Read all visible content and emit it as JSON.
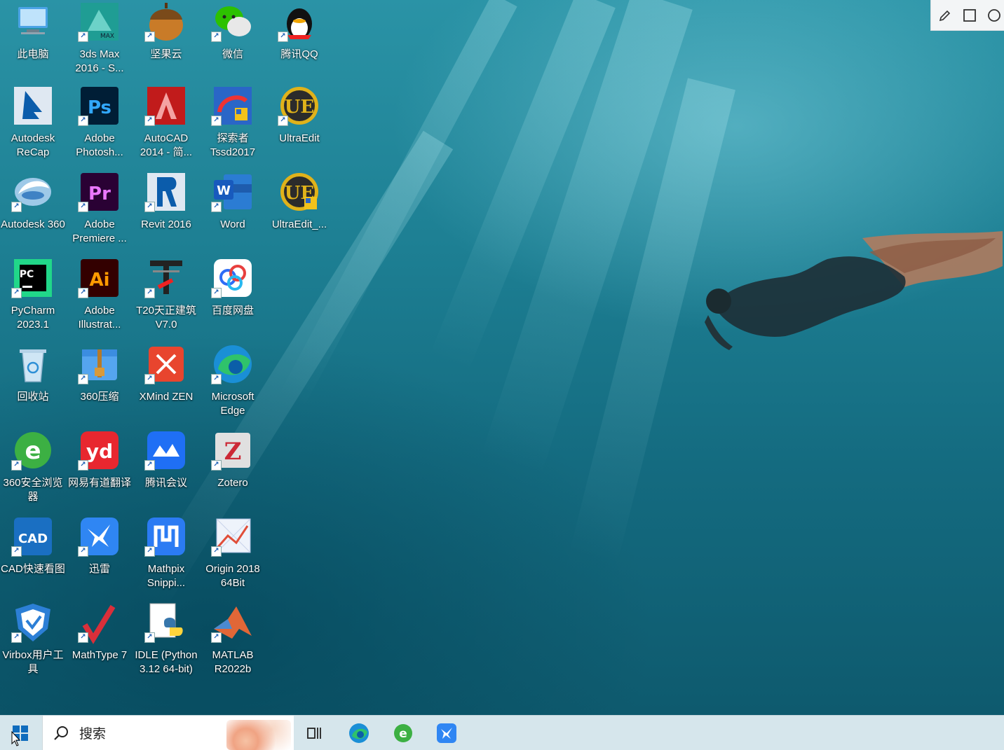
{
  "taskbar": {
    "search_placeholder": "搜索",
    "apps": [
      "task-view-icon",
      "edge-icon",
      "360-browser-icon",
      "xunlei-icon"
    ]
  },
  "snip_toolbar": {
    "tools": [
      "pencil-icon",
      "rectangle-icon",
      "circle-icon"
    ]
  },
  "desktop": {
    "icons": [
      {
        "label": "此电脑",
        "icon": "this-pc-icon",
        "shortcut": false
      },
      {
        "label": "3ds Max 2016 - S...",
        "icon": "3dsmax-icon",
        "shortcut": true
      },
      {
        "label": "坚果云",
        "icon": "jianguoyun-icon",
        "shortcut": true
      },
      {
        "label": "微信",
        "icon": "wechat-icon",
        "shortcut": true
      },
      {
        "label": "腾讯QQ",
        "icon": "qq-icon",
        "shortcut": true
      },
      {
        "label": "Autodesk ReCap",
        "icon": "recap-icon",
        "shortcut": false
      },
      {
        "label": "Adobe Photosh...",
        "icon": "photoshop-icon",
        "shortcut": true
      },
      {
        "label": "AutoCAD 2014 - 简...",
        "icon": "autocad-icon",
        "shortcut": true
      },
      {
        "label": "探索者 Tssd2017",
        "icon": "tssd-icon",
        "shortcut": true
      },
      {
        "label": "UltraEdit",
        "icon": "ultraedit-icon",
        "shortcut": true
      },
      {
        "label": "Autodesk 360",
        "icon": "autodesk360-icon",
        "shortcut": true
      },
      {
        "label": "Adobe Premiere ...",
        "icon": "premiere-icon",
        "shortcut": true
      },
      {
        "label": "Revit 2016",
        "icon": "revit-icon",
        "shortcut": true
      },
      {
        "label": "Word",
        "icon": "word-icon",
        "shortcut": true
      },
      {
        "label": "UltraEdit_...",
        "icon": "ultraedit2-icon",
        "shortcut": false
      },
      {
        "label": "PyCharm 2023.1",
        "icon": "pycharm-icon",
        "shortcut": true
      },
      {
        "label": "Adobe Illustrat...",
        "icon": "illustrator-icon",
        "shortcut": true
      },
      {
        "label": "T20天正建筑 V7.0",
        "icon": "t20-icon",
        "shortcut": true
      },
      {
        "label": "百度网盘",
        "icon": "baidu-netdisk-icon",
        "shortcut": true
      },
      {
        "label": "回收站",
        "icon": "recycle-bin-icon",
        "shortcut": false
      },
      {
        "label": "360压缩",
        "icon": "360zip-icon",
        "shortcut": true
      },
      {
        "label": "XMind ZEN",
        "icon": "xmind-icon",
        "shortcut": true
      },
      {
        "label": "Microsoft Edge",
        "icon": "edge-icon",
        "shortcut": true
      },
      {
        "label": "360安全浏览器",
        "icon": "360-browser-icon",
        "shortcut": true
      },
      {
        "label": "网易有道翻译",
        "icon": "youdao-icon",
        "shortcut": true
      },
      {
        "label": "腾讯会议",
        "icon": "tencent-meeting-icon",
        "shortcut": true
      },
      {
        "label": "Zotero",
        "icon": "zotero-icon",
        "shortcut": true
      },
      {
        "label": "CAD快速看图",
        "icon": "cad-viewer-icon",
        "shortcut": true
      },
      {
        "label": "迅雷",
        "icon": "xunlei-icon",
        "shortcut": true
      },
      {
        "label": "Mathpix Snippi...",
        "icon": "mathpix-icon",
        "shortcut": true
      },
      {
        "label": "Origin 2018 64Bit",
        "icon": "origin-icon",
        "shortcut": true
      },
      {
        "label": "Virbox用户工具",
        "icon": "virbox-icon",
        "shortcut": true
      },
      {
        "label": "MathType 7",
        "icon": "mathtype-icon",
        "shortcut": true
      },
      {
        "label": "IDLE (Python 3.12 64-bit)",
        "icon": "python-idle-icon",
        "shortcut": true
      },
      {
        "label": "MATLAB R2022b",
        "icon": "matlab-icon",
        "shortcut": true
      }
    ]
  }
}
